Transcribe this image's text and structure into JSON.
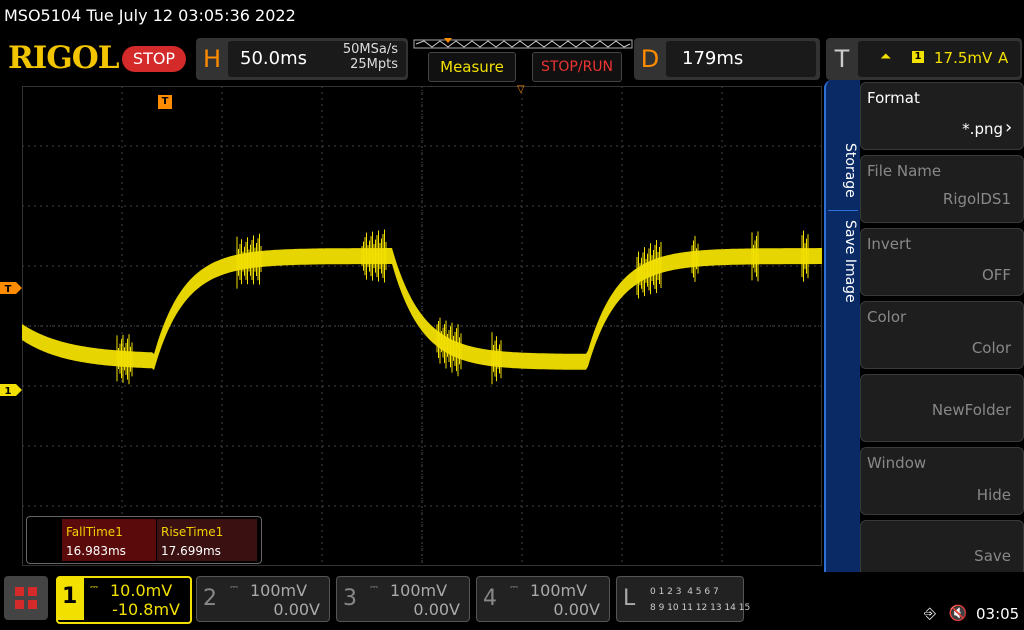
{
  "title_bar": {
    "text": "MSO5104  Tue July 12 03:05:36 2022"
  },
  "header": {
    "logo": "RIGOL",
    "run_state": "STOP",
    "horizontal": {
      "letter": "H",
      "timebase": "50.0ms",
      "sample_rate": "50MSa/s",
      "memory_depth": "25Mpts"
    },
    "measure_label": "Measure",
    "stoprun_label": "STOP/RUN",
    "delay": {
      "letter": "D",
      "value": "179ms"
    },
    "trigger": {
      "letter": "T",
      "edge_icon": "rising-edge-icon",
      "edge_glyph": "⏶",
      "source": "1",
      "level": "17.5mV",
      "mode": "A"
    }
  },
  "graticule": {
    "trigger_position_marker": "T",
    "trigger_level_marker": "T",
    "channel_marker": "1"
  },
  "measurements": [
    {
      "label": "FallTime1",
      "value": "16.983ms"
    },
    {
      "label": "RiseTime1",
      "value": "17.699ms"
    }
  ],
  "side_menu": {
    "tabs": [
      "Storage",
      "Save Image"
    ],
    "items": [
      {
        "label": "Format",
        "value": "*.png",
        "has_arrow": true,
        "enabled": true
      },
      {
        "label": "File Name",
        "value": "RigolDS1",
        "enabled": false
      },
      {
        "label": "Invert",
        "value": "OFF",
        "enabled": false
      },
      {
        "label": "Color",
        "value": "Color",
        "enabled": false
      },
      {
        "label": "",
        "value": "NewFolder",
        "enabled": false
      },
      {
        "label": "Window",
        "value": "Hide",
        "enabled": false
      },
      {
        "label": "",
        "value": "Save",
        "enabled": false
      }
    ]
  },
  "channels": [
    {
      "num": "1",
      "scale": "10.0mV",
      "offset": "-10.8mV",
      "active": true
    },
    {
      "num": "2",
      "scale": "100mV",
      "offset": "0.00V",
      "active": false
    },
    {
      "num": "3",
      "scale": "100mV",
      "offset": "0.00V",
      "active": false
    },
    {
      "num": "4",
      "scale": "100mV",
      "offset": "0.00V",
      "active": false
    }
  ],
  "logic": {
    "letter": "L",
    "row1": "0 1 2 3  4 5 6 7",
    "row2": "8 9 10 11 12 13 14 15"
  },
  "status": {
    "usb_icon": "usb-icon",
    "sound_icon": "speaker-muted-icon",
    "clock": "03:05"
  },
  "colors": {
    "ch1": "#f2e000",
    "horizontal": "#ff8c00",
    "stop": "#d42a2a",
    "menu_tab": "#0a2a66"
  }
}
